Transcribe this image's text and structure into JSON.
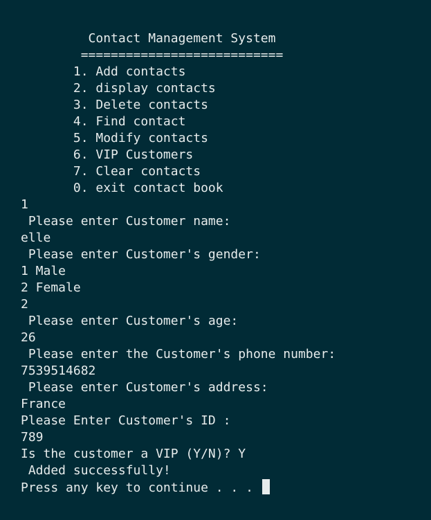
{
  "terminal": {
    "lines": [
      "         Contact Management System",
      "        ===========================",
      "       1. Add contacts",
      "       2. display contacts",
      "       3. Delete contacts",
      "       4. Find contact",
      "       5. Modify contacts",
      "       6. VIP Customers",
      "       7. Clear contacts",
      "       0. exit contact book",
      "1",
      " Please enter Customer name:",
      "elle",
      " Please enter Customer's gender:",
      "1 Male",
      "2 Female",
      "2",
      " Please enter Customer's age:",
      "26",
      " Please enter the Customer's phone number:",
      "7539514682",
      " Please enter Customer's address:",
      "France",
      "Please Enter Customer's ID :",
      "789",
      "Is the customer a VIP (Y/N)? Y",
      " Added successfully!",
      "Press any key to continue . . . "
    ]
  }
}
